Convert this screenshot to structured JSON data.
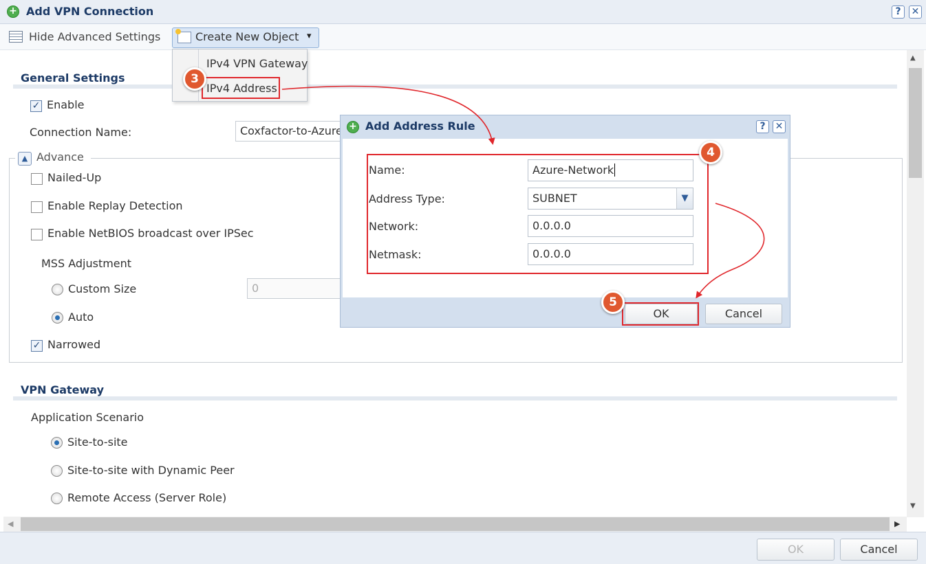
{
  "window": {
    "title": "Add VPN Connection",
    "help": "?",
    "close": "✕"
  },
  "toolbar": {
    "hide_advanced": "Hide Advanced Settings",
    "create_new_object": "Create New Object",
    "caret": "▾"
  },
  "menu": {
    "items": [
      "IPv4 VPN Gateway",
      "IPv4 Address"
    ]
  },
  "general": {
    "title": "General Settings",
    "enable_label": "Enable",
    "enable_checked": true,
    "connection_name_label": "Connection Name:",
    "connection_name_value": "Coxfactor-to-Azure"
  },
  "advance": {
    "title": "Advance",
    "toggle": "▲",
    "nailed_up": "Nailed-Up",
    "replay_detection": "Enable Replay Detection",
    "netbios": "Enable NetBIOS broadcast over IPSec",
    "mss_title": "MSS Adjustment",
    "custom_size": "Custom Size",
    "custom_size_value": "0",
    "auto": "Auto",
    "narrowed": "Narrowed"
  },
  "vpn_gateway": {
    "title": "VPN Gateway",
    "scenario_label": "Application Scenario",
    "options": [
      "Site-to-site",
      "Site-to-site with Dynamic Peer",
      "Remote Access (Server Role)"
    ],
    "selected": "Site-to-site"
  },
  "dialog": {
    "title": "Add Address Rule",
    "help": "?",
    "close": "✕",
    "fields": [
      {
        "label": "Name:",
        "value": "Azure-Network"
      },
      {
        "label": "Address Type:",
        "value": "SUBNET"
      },
      {
        "label": "Network:",
        "value": "0.0.0.0"
      },
      {
        "label": "Netmask:",
        "value": "0.0.0.0"
      }
    ],
    "ok": "OK",
    "cancel": "Cancel",
    "dropdown_arrow": "▼"
  },
  "footer": {
    "ok": "OK",
    "cancel": "Cancel"
  },
  "annotations": {
    "step3": "3",
    "step4": "4",
    "step5": "5",
    "color": "#e0262b"
  },
  "scroll": {
    "up": "▲",
    "down": "▼",
    "left": "◀",
    "right": "▶"
  }
}
